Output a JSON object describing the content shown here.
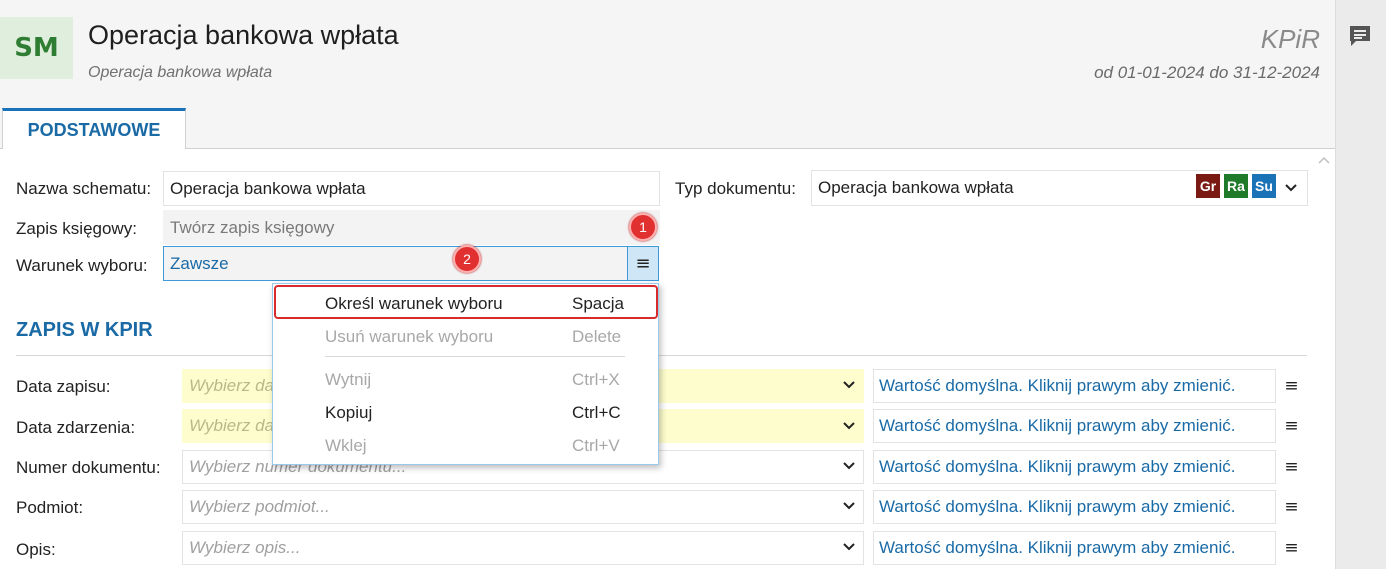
{
  "header": {
    "badge": "SM",
    "title": "Operacja bankowa wpłata",
    "subtitle": "Operacja bankowa wpłata",
    "module": "KPiR",
    "period": "od 01-01-2024 do 31-12-2024"
  },
  "tabs": [
    {
      "label": "PODSTAWOWE"
    }
  ],
  "form": {
    "name_label": "Nazwa schematu:",
    "name_value": "Operacja bankowa wpłata",
    "doc_type_label": "Typ dokumentu:",
    "doc_type_value": "Operacja bankowa wpłata",
    "doc_type_buttons": [
      {
        "label": "Gr",
        "color": "#7a1a12"
      },
      {
        "label": "Ra",
        "color": "#1f7a2a"
      },
      {
        "label": "Su",
        "color": "#1a73b7"
      }
    ],
    "entry_label": "Zapis księgowy:",
    "entry_value": "Twórz zapis księgowy",
    "cond_label": "Warunek wyboru:",
    "cond_value": "Zawsze",
    "menu_glyph": "≡"
  },
  "callouts": [
    "1",
    "2"
  ],
  "context_menu": {
    "items": [
      {
        "label": "Określ warunek wyboru",
        "shortcut": "Spacja",
        "enabled": true
      },
      {
        "label": "Usuń warunek wyboru",
        "shortcut": "Delete",
        "enabled": false
      },
      {
        "label": "Wytnij",
        "shortcut": "Ctrl+X",
        "enabled": false
      },
      {
        "label": "Kopiuj",
        "shortcut": "Ctrl+C",
        "enabled": true
      },
      {
        "label": "Wklej",
        "shortcut": "Ctrl+V",
        "enabled": false
      }
    ]
  },
  "kpir_section": {
    "title": "ZAPIS W KPIR",
    "rows": [
      {
        "label": "Data zapisu:",
        "placeholder": "Wybierz da",
        "default": "Wartość domyślna. Kliknij prawym aby zmienić.",
        "style": "yellow"
      },
      {
        "label": "Data zdarzenia:",
        "placeholder": "Wybierz da",
        "default": "Wartość domyślna. Kliknij prawym aby zmienić.",
        "style": "yellow"
      },
      {
        "label": "Numer dokumentu:",
        "placeholder": "Wybierz numer dokumentu...",
        "default": "Wartość domyślna. Kliknij prawym aby zmienić.",
        "style": "white"
      },
      {
        "label": "Podmiot:",
        "placeholder": "Wybierz podmiot...",
        "default": "Wartość domyślna. Kliknij prawym aby zmienić.",
        "style": "white"
      },
      {
        "label": "Opis:",
        "placeholder": "Wybierz opis...",
        "default": "Wartość domyślna. Kliknij prawym aby zmienić.",
        "style": "white"
      }
    ],
    "row_menu_glyph": "≡"
  },
  "icons": {
    "chat": "chat-icon",
    "chevron": "chevron-down-icon",
    "scroll": "scroll-up-icon"
  }
}
